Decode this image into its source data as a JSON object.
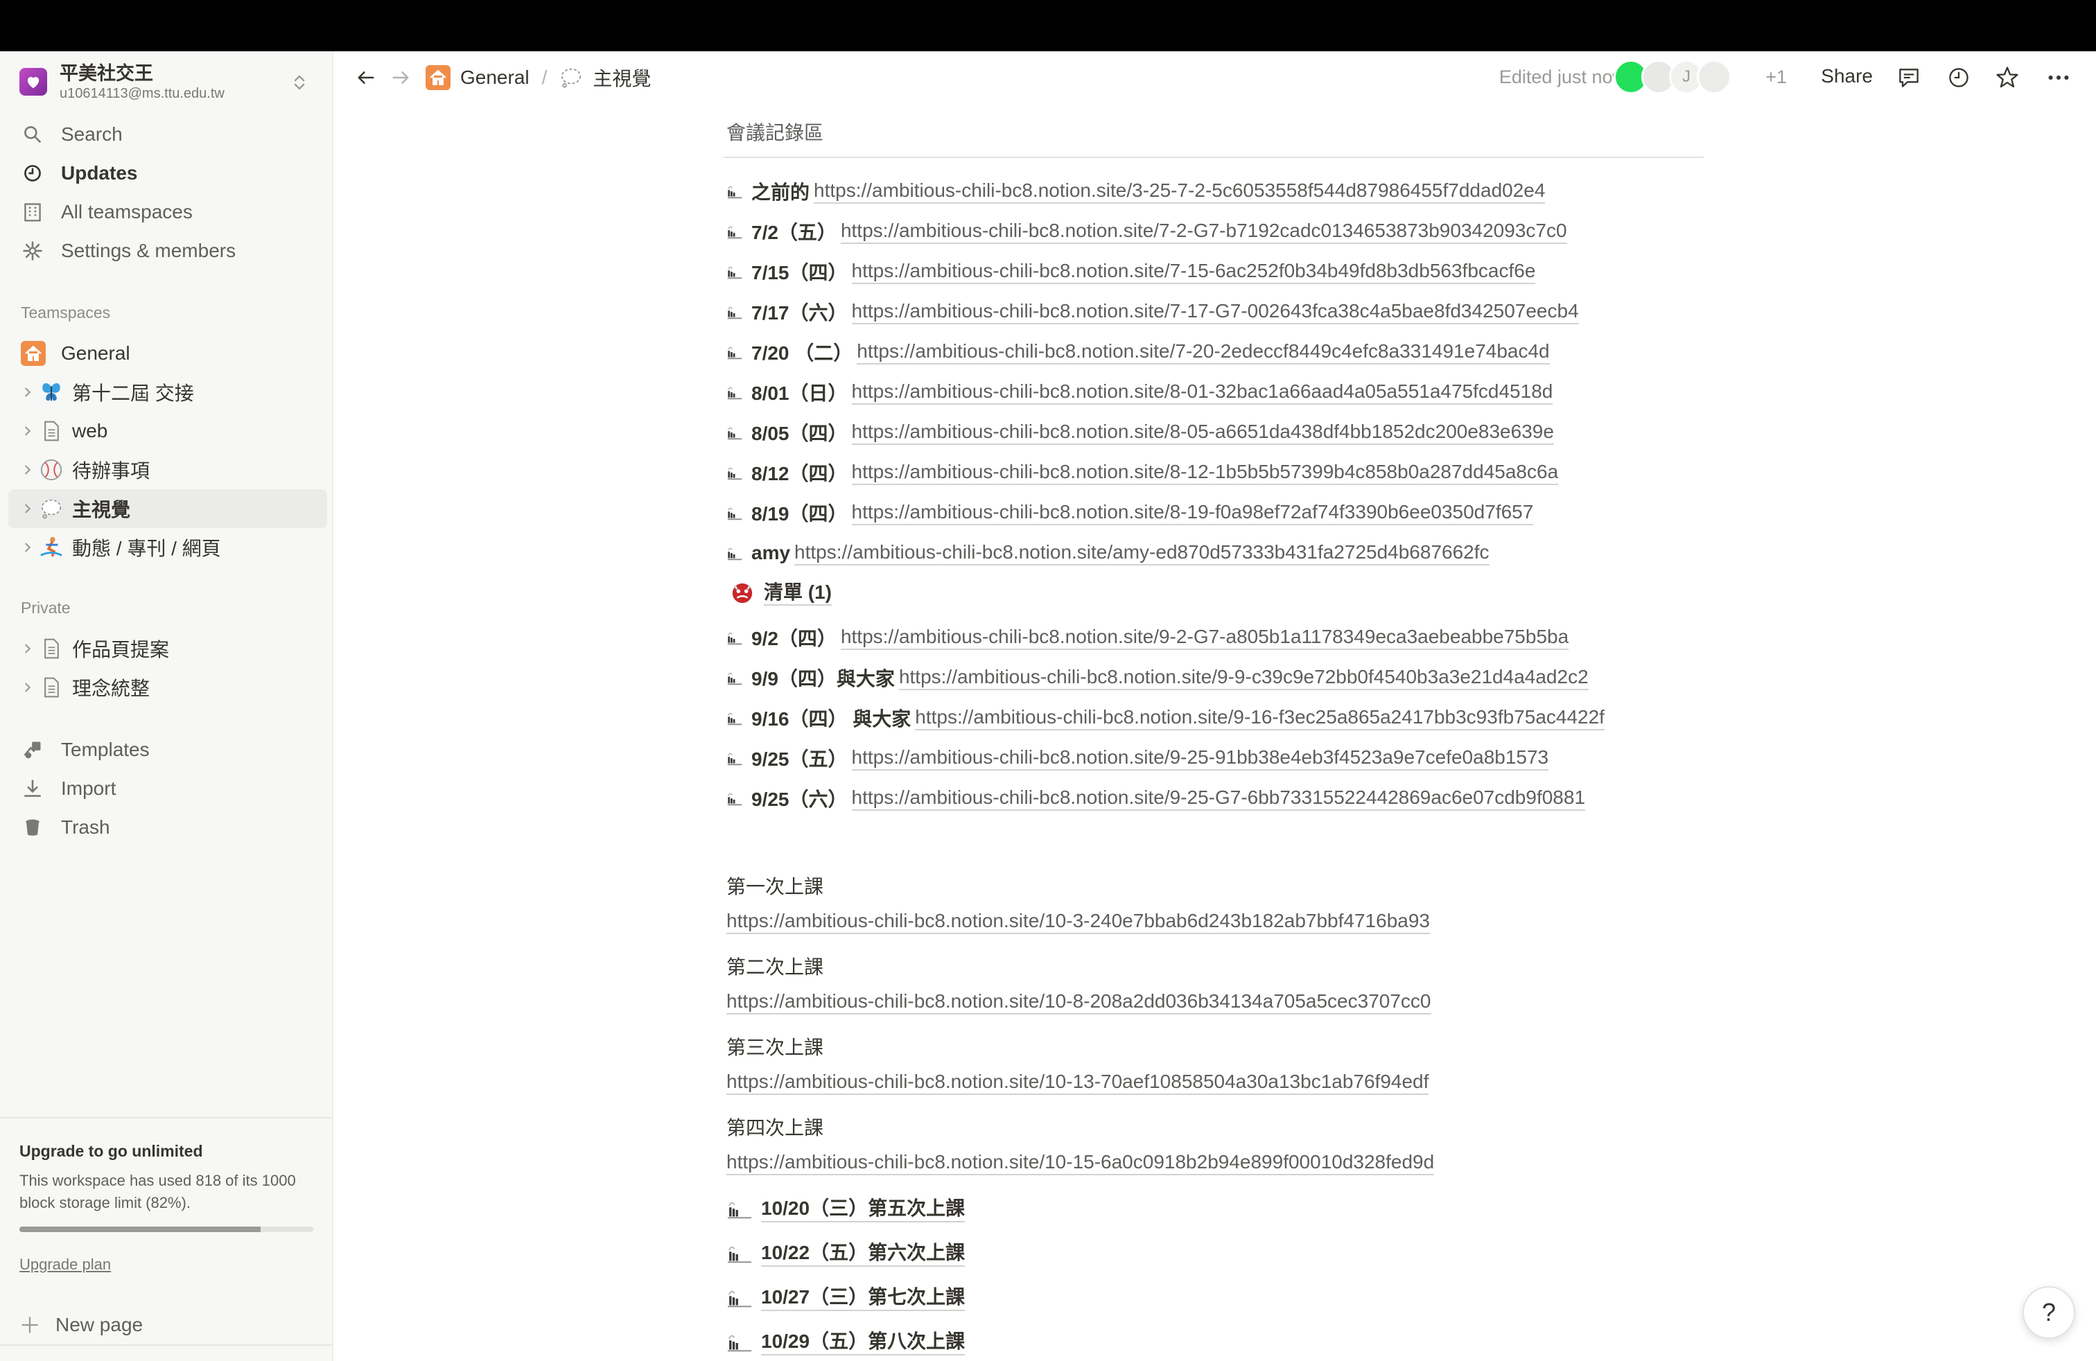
{
  "workspace": {
    "name": "平美社交王",
    "email": "u10614113@ms.ttu.edu.tw"
  },
  "sidebar": {
    "nav": [
      {
        "label": "Search",
        "icon": "search-icon"
      },
      {
        "label": "Updates",
        "icon": "clock-icon"
      },
      {
        "label": "All teamspaces",
        "icon": "building-icon"
      },
      {
        "label": "Settings & members",
        "icon": "gear-icon"
      }
    ],
    "teamspaces_label": "Teamspaces",
    "teamspaces": [
      {
        "label": "General",
        "icon": "home-icon"
      },
      {
        "label": "第十二屆 交接",
        "icon": "butterfly-icon"
      },
      {
        "label": "web",
        "icon": "page-icon"
      },
      {
        "label": "待辦事項",
        "icon": "baseball-icon"
      },
      {
        "label": "主視覺",
        "icon": "speech-bubble-icon"
      },
      {
        "label": "動態 / 專刊 / 網頁",
        "icon": "surfer-icon"
      }
    ],
    "private_label": "Private",
    "private": [
      {
        "label": "作品頁提案",
        "icon": "page-icon"
      },
      {
        "label": "理念統整",
        "icon": "page-icon"
      }
    ],
    "utilities": [
      {
        "label": "Templates",
        "icon": "templates-icon"
      },
      {
        "label": "Import",
        "icon": "import-icon"
      },
      {
        "label": "Trash",
        "icon": "trash-icon"
      }
    ],
    "upgrade": {
      "title": "Upgrade to go unlimited",
      "description": "This workspace has used 818 of its 1000 block storage limit (82%).",
      "usage_fraction": 0.82,
      "link": "Upgrade plan"
    },
    "new_page": "New page"
  },
  "header": {
    "breadcrumb": [
      {
        "label": "General",
        "icon": "home-icon"
      },
      {
        "label": "主視覺",
        "icon": "speech-bubble-icon"
      }
    ],
    "separator": "/",
    "edited": "Edited just now",
    "more_count": "+1",
    "avatar_initial": "J",
    "share": "Share"
  },
  "page": {
    "section_title": "會議記錄區",
    "entries": [
      {
        "label": "之前的",
        "url": "https://ambitious-chili-bc8.notion.site/3-25-7-2-5c6053558f544d87986455f7ddad02e4"
      },
      {
        "label": "7/2（五）",
        "url": "https://ambitious-chili-bc8.notion.site/7-2-G7-b7192cadc0134653873b90342093c7c0"
      },
      {
        "label": "7/15（四）",
        "url": "https://ambitious-chili-bc8.notion.site/7-15-6ac252f0b34b49fd8b3db563fbcacf6e"
      },
      {
        "label": "7/17（六）",
        "url": "https://ambitious-chili-bc8.notion.site/7-17-G7-002643fca38c4a5bae8fd342507eecb4"
      },
      {
        "label": "7/20 （二）",
        "url": "https://ambitious-chili-bc8.notion.site/7-20-2edeccf8449c4efc8a331491e74bac4d"
      },
      {
        "label": "8/01（日）",
        "url": "https://ambitious-chili-bc8.notion.site/8-01-32bac1a66aad4a05a551a475fcd4518d"
      },
      {
        "label": "8/05（四）",
        "url": "https://ambitious-chili-bc8.notion.site/8-05-a6651da438df4bb1852dc200e83e639e"
      },
      {
        "label": "8/12（四）",
        "url": "https://ambitious-chili-bc8.notion.site/8-12-1b5b5b57399b4c858b0a287dd45a8c6a"
      },
      {
        "label": "8/19（四）",
        "url": "https://ambitious-chili-bc8.notion.site/8-19-f0a98ef72af74f3390b6ee0350d7f657"
      },
      {
        "label": "amy",
        "url": "https://ambitious-chili-bc8.notion.site/amy-ed870d57333b431fa2725d4b687662fc"
      }
    ],
    "checklist": {
      "label": "清單 (1)",
      "icon": "ogre-icon"
    },
    "entries2": [
      {
        "label": "9/2（四）",
        "url": "https://ambitious-chili-bc8.notion.site/9-2-G7-a805b1a1178349eca3aebeabbe75b5ba"
      },
      {
        "label": "9/9（四）與大家",
        "url": "https://ambitious-chili-bc8.notion.site/9-9-c39c9e72bb0f4540b3a3e21d4a4ad2c2"
      },
      {
        "label": "9/16（四） 與大家",
        "url": "https://ambitious-chili-bc8.notion.site/9-16-f3ec25a865a2417bb3c93fb75ac4422f"
      },
      {
        "label": "9/25（五）",
        "url": "https://ambitious-chili-bc8.notion.site/9-25-91bb38e4eb3f4523a9e7cefe0a8b1573"
      },
      {
        "label": "9/25（六）",
        "url": "https://ambitious-chili-bc8.notion.site/9-25-G7-6bb73315522442869ac6e07cdb9f0881"
      }
    ],
    "classes": [
      {
        "title": "第一次上課",
        "url": "https://ambitious-chili-bc8.notion.site/10-3-240e7bbab6d243b182ab7bbf4716ba93"
      },
      {
        "title": "第二次上課",
        "url": "https://ambitious-chili-bc8.notion.site/10-8-208a2dd036b34134a705a5cec3707cc0"
      },
      {
        "title": "第三次上課",
        "url": "https://ambitious-chili-bc8.notion.site/10-13-70aef10858504a30a13bc1ab76f94edf"
      },
      {
        "title": "第四次上課",
        "url": "https://ambitious-chili-bc8.notion.site/10-15-6a0c0918b2b94e899f00010d328fed9d"
      }
    ],
    "subpages": [
      {
        "label": "10/20（三）第五次上課"
      },
      {
        "label": "10/22（五）第六次上課"
      },
      {
        "label": "10/27（三）第七次上課"
      },
      {
        "label": "10/29（五）第八次上課"
      }
    ]
  },
  "help": "?"
}
